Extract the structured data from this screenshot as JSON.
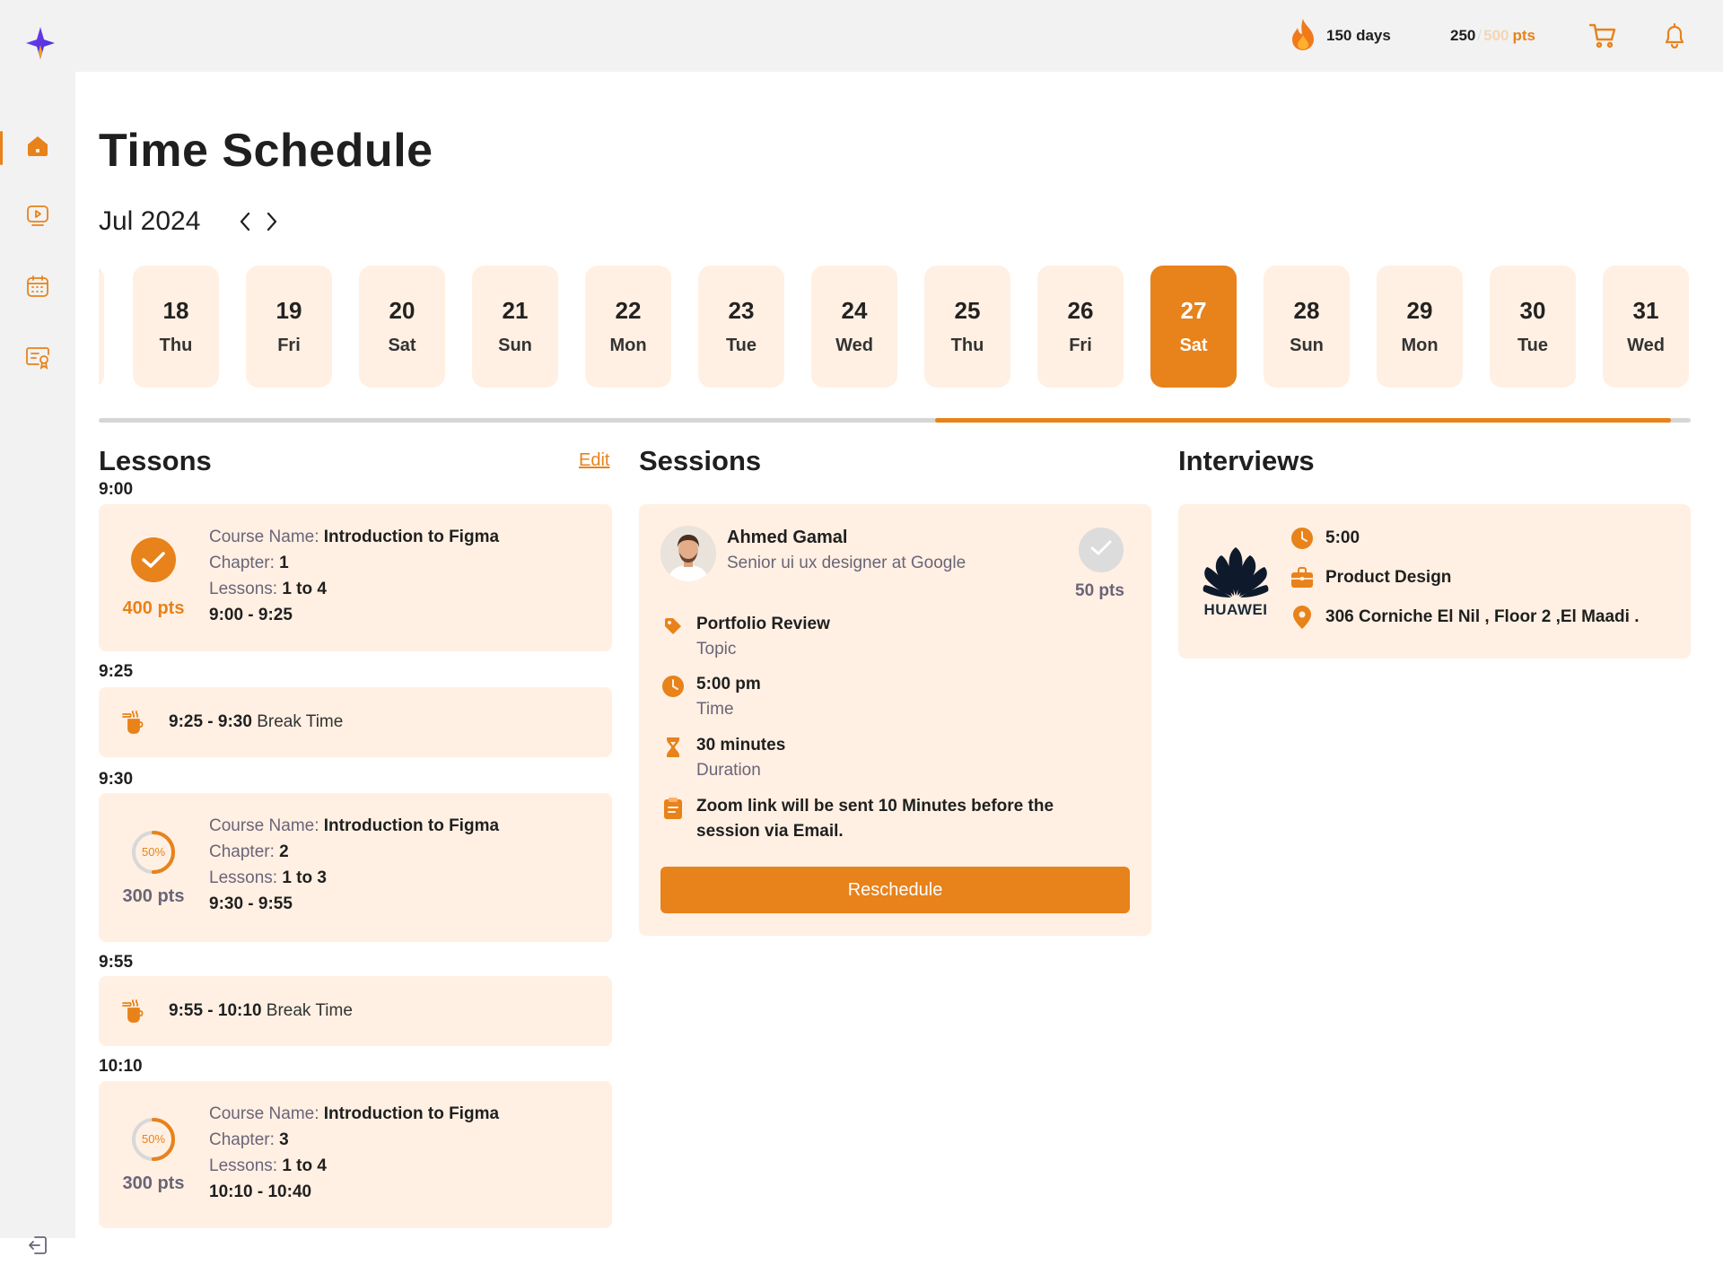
{
  "topbar": {
    "streak": "150 days",
    "points_current": "250",
    "points_sep": "/",
    "points_max": "500",
    "points_unit": "pts"
  },
  "sidebar": {
    "items": [
      {
        "icon": "home-icon",
        "active": true
      },
      {
        "icon": "video-icon",
        "active": false
      },
      {
        "icon": "calendar-icon",
        "active": false
      },
      {
        "icon": "certificate-icon",
        "active": false
      }
    ],
    "logout_icon": "logout-icon"
  },
  "page": {
    "title": "Time Schedule",
    "month": "Jul 2024"
  },
  "days": [
    {
      "num": "18",
      "dow": "Thu"
    },
    {
      "num": "19",
      "dow": "Fri"
    },
    {
      "num": "20",
      "dow": "Sat"
    },
    {
      "num": "21",
      "dow": "Sun"
    },
    {
      "num": "22",
      "dow": "Mon"
    },
    {
      "num": "23",
      "dow": "Tue"
    },
    {
      "num": "24",
      "dow": "Wed"
    },
    {
      "num": "25",
      "dow": "Thu"
    },
    {
      "num": "26",
      "dow": "Fri"
    },
    {
      "num": "27",
      "dow": "Sat",
      "selected": true
    },
    {
      "num": "28",
      "dow": "Sun"
    },
    {
      "num": "29",
      "dow": "Mon"
    },
    {
      "num": "30",
      "dow": "Tue"
    },
    {
      "num": "31",
      "dow": "Wed"
    }
  ],
  "lessons": {
    "title": "Lessons",
    "edit": "Edit",
    "course_label": "Course Name:",
    "chapter_label": "Chapter:",
    "lessons_label": "Lessons:",
    "blocks": [
      {
        "time": "9:00",
        "course": "Introduction to Figma",
        "chapter": "1",
        "lessons": "1 to 4",
        "range": "9:00 - 9:25",
        "pts": "400 pts",
        "status": "done"
      },
      {
        "time": "9:25",
        "break_range": "9:25 - 9:30",
        "break_label": "Break Time"
      },
      {
        "time": "9:30",
        "course": "Introduction to Figma",
        "chapter": "2",
        "lessons": "1 to 3",
        "range": "9:30 - 9:55",
        "pts": "300 pts",
        "progress": "50%"
      },
      {
        "time": "9:55",
        "break_range": "9:55 - 10:10",
        "break_label": "Break Time"
      },
      {
        "time": "10:10",
        "course": "Introduction to Figma",
        "chapter": "3",
        "lessons": "1 to 4",
        "range": "10:10 - 10:40",
        "pts": "300 pts",
        "progress": "50%"
      }
    ]
  },
  "sessions": {
    "title": "Sessions",
    "name": "Ahmed Gamal",
    "role": "Senior ui ux designer at Google",
    "pts": "50 pts",
    "topic": "Portfolio Review",
    "topic_label": "Topic",
    "time": "5:00 pm",
    "time_label": "Time",
    "duration": "30 minutes",
    "duration_label": "Duration",
    "note": "Zoom link will be sent 10 Minutes before the session via Email.",
    "button": "Reschedule"
  },
  "interviews": {
    "title": "Interviews",
    "company": "HUAWEI",
    "time": "5:00",
    "role": "Product Design",
    "location": "306 Corniche El Nil , Floor 2 ,El Maadi ."
  },
  "colors": {
    "accent": "#e8821a",
    "card_bg": "#fff0e3",
    "muted_text": "#6b6478"
  }
}
